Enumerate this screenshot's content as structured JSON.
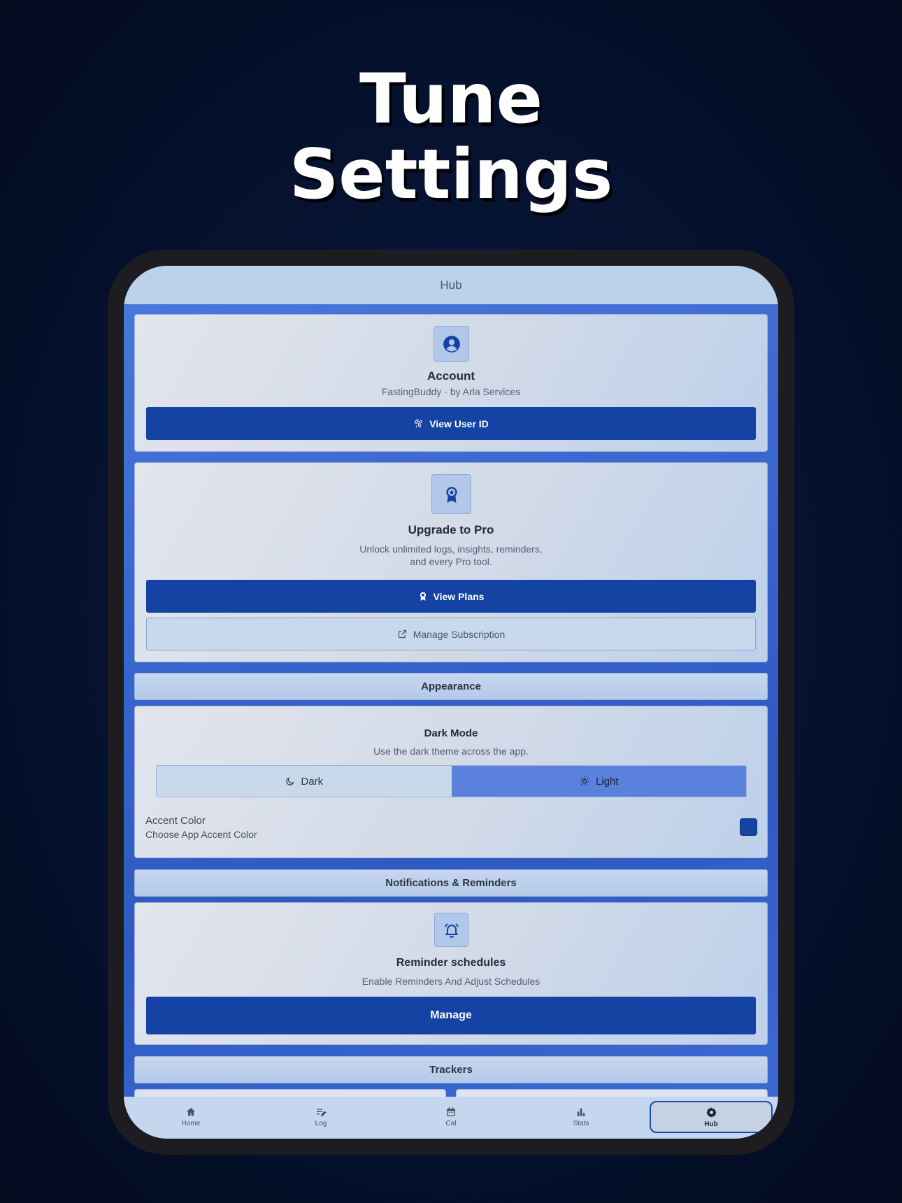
{
  "headline": {
    "line1": "Tune",
    "line2": "Settings"
  },
  "appbar": {
    "title": "Hub"
  },
  "account": {
    "title": "Account",
    "subtitle": "FastingBuddy · by Arla Services",
    "button_label": "View User ID",
    "icon": "account-circle-icon"
  },
  "upgrade": {
    "title": "Upgrade to Pro",
    "desc_line1": "Unlock unlimited logs, insights, reminders,",
    "desc_line2": "and every Pro tool.",
    "plans_label": "View Plans",
    "manage_label": "Manage Subscription",
    "icon": "award-ribbon-icon"
  },
  "appearance": {
    "section_label": "Appearance",
    "dark_mode_title": "Dark Mode",
    "dark_mode_desc": "Use the dark theme across the app.",
    "dark_label": "Dark",
    "light_label": "Light",
    "selected": "Light",
    "accent_title": "Accent Color",
    "accent_desc": "Choose App Accent Color",
    "accent_color": "#1443a3"
  },
  "notifications": {
    "section_label": "Notifications & Reminders",
    "title": "Reminder schedules",
    "desc": "Enable Reminders And Adjust Schedules",
    "button_label": "Manage",
    "icon": "bell-ring-icon"
  },
  "trackers": {
    "section_label": "Trackers"
  },
  "nav": {
    "items": [
      {
        "label": "Home",
        "icon": "home-icon"
      },
      {
        "label": "Log",
        "icon": "log-edit-icon"
      },
      {
        "label": "Cal",
        "icon": "calendar-icon"
      },
      {
        "label": "Stats",
        "icon": "bar-chart-icon"
      },
      {
        "label": "Hub",
        "icon": "gear-icon"
      }
    ],
    "active": "Hub"
  },
  "colors": {
    "primary": "#1443a3",
    "background": "#061433",
    "segment_active": "#5a82dc"
  }
}
